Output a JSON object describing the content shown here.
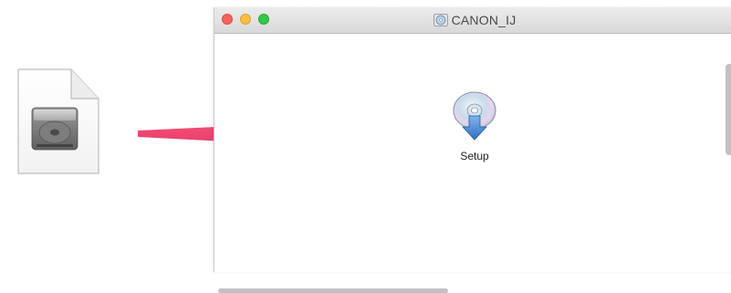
{
  "desktop": {
    "dmg_file_icon": "hard-disk-document-icon"
  },
  "arrow": {
    "color": "#f0436f",
    "icon": "right-arrow-icon"
  },
  "window": {
    "title": "CANON_IJ",
    "title_icon": "disc-image-icon",
    "traffic_lights": {
      "close_color": "#fc605b",
      "minimize_color": "#fdbc40",
      "zoom_color": "#34c84a"
    }
  },
  "files": [
    {
      "label": "Setup",
      "icon": "setup-installer-icon"
    }
  ]
}
